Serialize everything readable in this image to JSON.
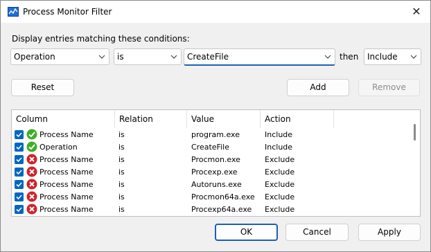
{
  "window": {
    "title": "Process Monitor Filter",
    "close_glyph": "✕",
    "app_icon": "process-monitor-icon"
  },
  "conditions_label": "Display entries matching these conditions:",
  "filter": {
    "column": "Operation",
    "relation": "is",
    "value": "CreateFile",
    "then_label": "then",
    "action": "Include"
  },
  "buttons": {
    "reset": "Reset",
    "add": "Add",
    "remove": "Remove",
    "ok": "OK",
    "cancel": "Cancel",
    "apply": "Apply"
  },
  "table": {
    "columns": [
      "Column",
      "Relation",
      "Value",
      "Action"
    ],
    "rows": [
      {
        "column": "Process Name",
        "relation": "is",
        "value": "program.exe",
        "action": "Include",
        "status": "include-icon",
        "checked": true
      },
      {
        "column": "Operation",
        "relation": "is",
        "value": "CreateFile",
        "action": "Include",
        "status": "include-icon",
        "checked": true
      },
      {
        "column": "Process Name",
        "relation": "is",
        "value": "Procmon.exe",
        "action": "Exclude",
        "status": "exclude-icon",
        "checked": true
      },
      {
        "column": "Process Name",
        "relation": "is",
        "value": "Procexp.exe",
        "action": "Exclude",
        "status": "exclude-icon",
        "checked": true
      },
      {
        "column": "Process Name",
        "relation": "is",
        "value": "Autoruns.exe",
        "action": "Exclude",
        "status": "exclude-icon",
        "checked": true
      },
      {
        "column": "Process Name",
        "relation": "is",
        "value": "Procmon64a.exe",
        "action": "Exclude",
        "status": "exclude-icon",
        "checked": true
      },
      {
        "column": "Process Name",
        "relation": "is",
        "value": "Procexp64a.exe",
        "action": "Exclude",
        "status": "exclude-icon",
        "checked": true
      }
    ]
  },
  "colors": {
    "accent": "#1a5fb4",
    "checkbox": "#0067c0",
    "include": "#3fae29",
    "exclude": "#d0232b"
  }
}
